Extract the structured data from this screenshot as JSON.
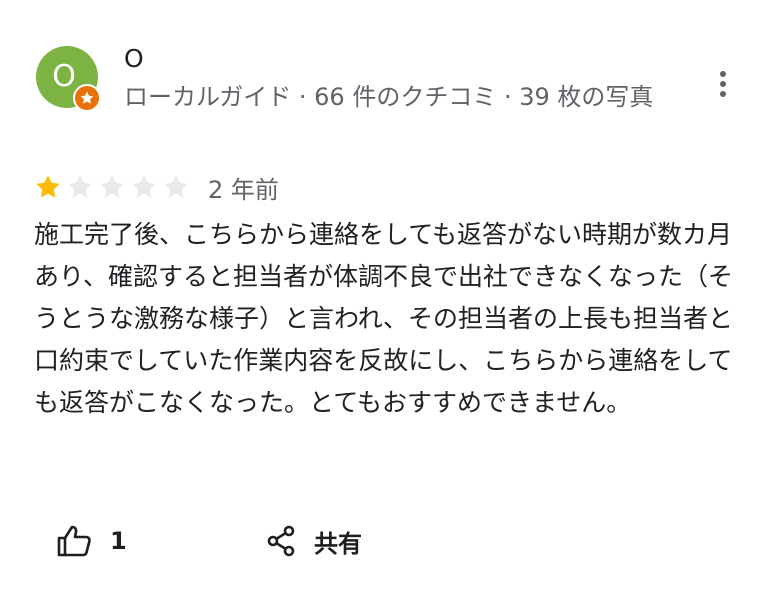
{
  "reviewer": {
    "initial": "O",
    "name": "O",
    "meta": "ローカルガイド · 66 件のクチコミ · 39 枚の写真"
  },
  "review": {
    "rating": 1,
    "max_rating": 5,
    "time": "2 年前",
    "text": "施工完了後、こちらから連絡をしても返答がない時期が数カ月あり、確認すると担当者が体調不良で出社できなくなった（そうとうな激務な様子）と言われ、その担当者の上長も担当者と口約束でしていた作業内容を反故にし、こちらから連絡をしても返答がこなくなった。とてもおすすめできません。"
  },
  "actions": {
    "like_count": "1",
    "share_label": "共有"
  },
  "colors": {
    "avatar_bg": "#7cb342",
    "badge_bg": "#e8710a",
    "star_filled": "#fbbc04",
    "star_empty": "#e8eaed",
    "secondary_text": "#5f6368"
  },
  "icons": {
    "more": "more-vert-icon",
    "like": "thumb-up-icon",
    "share": "share-icon",
    "badge": "local-guide-star-icon",
    "star": "star-icon"
  }
}
